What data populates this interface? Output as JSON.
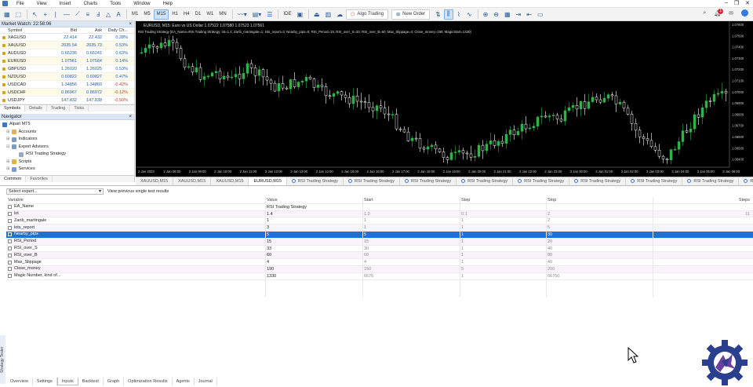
{
  "menu": [
    "File",
    "View",
    "Insert",
    "Charts",
    "Tools",
    "Window",
    "Help"
  ],
  "toolbar": {
    "timeframes": [
      "M1",
      "M5",
      "M15",
      "H1",
      "H4",
      "D1",
      "W1",
      "MN"
    ],
    "selected_timeframe": "M15",
    "ide_label": "IDE",
    "algo_label": "Algo Trading",
    "neworder_label": "New Order",
    "alert_count": "1"
  },
  "market_watch": {
    "title": "Market Watch: 22:58:06",
    "headers": [
      "Symbol",
      "Bid",
      "Ask",
      "Daily Ch..."
    ],
    "rows": [
      {
        "symbol": "XAGUSD",
        "bid": "22.414",
        "ask": "22.432",
        "change": "0.28%",
        "dir": "pos"
      },
      {
        "symbol": "XAUUSD",
        "bid": "2035.54",
        "ask": "2035.73",
        "change": "0.53%",
        "dir": "pos"
      },
      {
        "symbol": "AUDUSD",
        "bid": "0.65236",
        "ask": "0.65241",
        "change": "0.63%",
        "dir": "pos"
      },
      {
        "symbol": "EURUSD",
        "bid": "1.07561",
        "ask": "1.07564",
        "change": "0.14%",
        "dir": "pos"
      },
      {
        "symbol": "GBPUSD",
        "bid": "1.26020",
        "ask": "1.26025",
        "change": "0.53%",
        "dir": "pos"
      },
      {
        "symbol": "NZDUSD",
        "bid": "0.60822",
        "ask": "0.60827",
        "change": "0.47%",
        "dir": "pos"
      },
      {
        "symbol": "USDCAD",
        "bid": "1.34856",
        "ask": "1.34860",
        "change": "-0.42%",
        "dir": "neg"
      },
      {
        "symbol": "USDCHF",
        "bid": "0.86967",
        "ask": "0.86972",
        "change": "-0.12%",
        "dir": "neg"
      },
      {
        "symbol": "USDJPY",
        "bid": "147.832",
        "ask": "147.838",
        "change": "-0.50%",
        "dir": "neg"
      }
    ],
    "tabs": [
      "Symbols",
      "Details",
      "Trading",
      "Ticks"
    ]
  },
  "navigator": {
    "title": "Navigator",
    "items": [
      "Alpari MT5",
      "Accounts",
      "Indicators",
      "Expert Advisors",
      "RSI Trading Strategy",
      "Scripts",
      "Services"
    ],
    "tabs": [
      "Common",
      "Favorites"
    ]
  },
  "chart": {
    "symbol_line": "EURUSD, M15:  Euro vs US Dollar  1.07522 1.07580 1.07523 1.07561",
    "ea_line": "RSI Trading Strategy [EA_Name=RSI Trading Strategy; lot=1.4; Zarib_martingale=1; lots_report=3; Nearby_pips=5; RSI_Period=15; RSI_over_S=33; RSI_over_B=60; Max_Slippage=4; Close_money=190; MagicStart=1330]",
    "price_labels": [
      "1.07600",
      "1.07500",
      "1.07400",
      "1.07300",
      "1.07200",
      "1.07100",
      "1.07000",
      "1.06900",
      "1.06800",
      "1.06700",
      "1.06600",
      "1.06500",
      "1.06400"
    ],
    "time_labels": [
      "2 Jan 2023",
      "2 Jan 08:00",
      "2 Jan 09:00",
      "2 Jan 10:00",
      "2 Jan 11:00",
      "2 Jan 12:00",
      "2 Jan 13:00",
      "2 Jan 14:00",
      "2 Jan 15:00",
      "2 Jan 16:00",
      "2 Jan 17:00",
      "2 Jan 18:00",
      "2 Jan 19:00",
      "2 Jan 20:00",
      "2 Jan 21:00",
      "2 Jan 22:00",
      "2 Jan 23:00",
      "3 Jan 00:00",
      "3 Jan 01:00",
      "3 Jan 02:00",
      "3 Jan 03:00",
      "3 Jan 04:00",
      "3 Jan 05:00",
      "3 Jan 06:00"
    ],
    "tabs": [
      "XAUUSD,M15",
      "XAUUSD,M15",
      "XAUUSD,M15",
      "EURUSD,M15",
      "RSI Trading Strategy",
      "RSI Trading Strategy",
      "RSI Trading Strategy",
      "RSI Trading Strategy",
      "RSI Trading Strategy",
      "RSI Trading Strategy",
      "RSI Trading Strategy",
      "RSI Trading Strategy",
      "RSI Trac"
    ],
    "active_tab": 3
  },
  "tester": {
    "expert_select": "Select expert...",
    "description": "View previous single test results",
    "headers": [
      "Variable",
      "Value",
      "Start",
      "Step",
      "Stop",
      "Steps"
    ],
    "rows": [
      {
        "variable": "EA_Name",
        "value": "RSI Trading Strategy",
        "start": "",
        "step": "",
        "stop": "",
        "steps": ""
      },
      {
        "variable": "lot",
        "value": "1.4",
        "start": "1.0",
        "step": "0.1",
        "stop": "2",
        "steps": "11"
      },
      {
        "variable": "Zarib_martingale",
        "value": "1",
        "start": "1",
        "step": "1",
        "stop": "2",
        "steps": ""
      },
      {
        "variable": "lots_report",
        "value": "3",
        "start": "1",
        "step": "1",
        "stop": "5",
        "steps": ""
      },
      {
        "variable": "Nearby_pips",
        "value": "5",
        "start": "5",
        "step": "1",
        "stop": "30",
        "steps": ""
      },
      {
        "variable": "RSI_Period",
        "value": "15",
        "start": "15",
        "step": "1",
        "stop": "20",
        "steps": ""
      },
      {
        "variable": "RSI_over_S",
        "value": "33",
        "start": "30",
        "step": "1",
        "stop": "40",
        "steps": ""
      },
      {
        "variable": "RSI_over_B",
        "value": "60",
        "start": "60",
        "step": "1",
        "stop": "80",
        "steps": ""
      },
      {
        "variable": "Max_Slippage",
        "value": "4",
        "start": "4",
        "step": "1",
        "stop": "40",
        "steps": ""
      },
      {
        "variable": "Close_money",
        "value": "190",
        "start": "150",
        "step": "5",
        "stop": "200",
        "steps": ""
      },
      {
        "variable": "Magic Number, kind of...",
        "value": "1330",
        "start": "6676",
        "step": "1",
        "stop": "66760",
        "steps": ""
      }
    ],
    "selected_row": 4,
    "side_label": "Strategy Tester",
    "bottom_tabs": [
      "Overview",
      "Settings",
      "Inputs",
      "Backtest",
      "Graph",
      "Optimization Results",
      "Agents",
      "Journal"
    ],
    "active_bottom_tab": 2
  },
  "colors": {
    "bull": "#2fb24a",
    "bear": "#ffffff",
    "selection": "#1d73d2",
    "chart_bg": "#000000"
  }
}
